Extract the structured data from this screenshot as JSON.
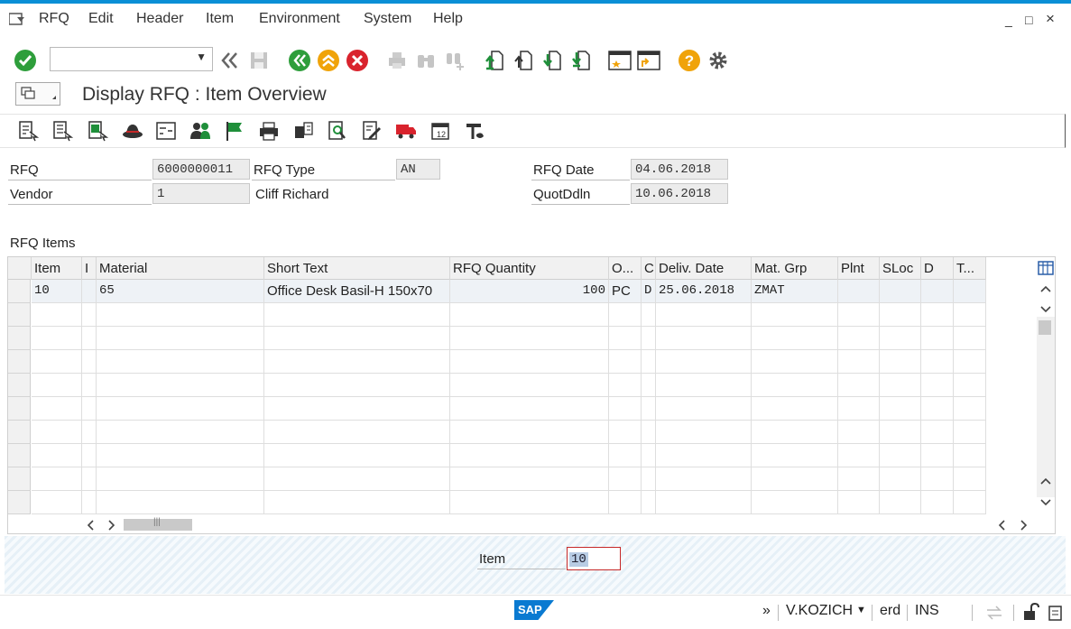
{
  "menu": [
    "RFQ",
    "Edit",
    "Header",
    "Item",
    "Environment",
    "System",
    "Help"
  ],
  "window_controls": [
    "_",
    "□",
    "×"
  ],
  "toolbar": {
    "command_value": ""
  },
  "title": "Display RFQ : Item Overview",
  "header": {
    "rfq_label": "RFQ",
    "rfq_value": "6000000011",
    "rfq_type_label": "RFQ Type",
    "rfq_type_value": "AN",
    "rfq_date_label": "RFQ Date",
    "rfq_date_value": "04.06.2018",
    "vendor_label": "Vendor",
    "vendor_value": "1",
    "vendor_name": "Cliff Richard",
    "quotddln_label": "QuotDdln",
    "quotddln_value": "10.06.2018"
  },
  "table": {
    "title": "RFQ Items",
    "columns": [
      "Item",
      "I",
      "Material",
      "Short Text",
      "RFQ Quantity",
      "O...",
      "C",
      "Deliv. Date",
      "Mat. Grp",
      "Plnt",
      "SLoc",
      "D",
      "T..."
    ],
    "rows": [
      {
        "item": "10",
        "i": "",
        "material": "65",
        "short_text": "Office Desk Basil-H 150x70",
        "qty": "100",
        "unit": "PC",
        "c": "D",
        "deliv_date": "25.06.2018",
        "mat_grp": "ZMAT",
        "plnt": "",
        "sloc": "",
        "d": "",
        "t": ""
      }
    ]
  },
  "footer": {
    "item_label": "Item",
    "item_value": "10"
  },
  "status": {
    "arrows": "»",
    "user": "V.KOZICH",
    "system": "erd",
    "mode": "INS",
    "logo": "SAP"
  },
  "colors": {
    "accent": "#0a8fd6",
    "green": "#2e9e3b",
    "orange": "#f0a30a",
    "red": "#d9232d"
  }
}
